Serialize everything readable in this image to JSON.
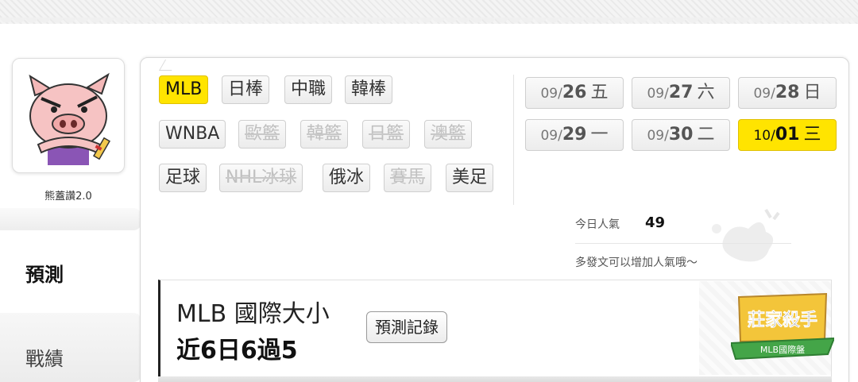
{
  "user": {
    "name": "熊蓋讚2.0"
  },
  "sidebar": {
    "predict_label": "預測",
    "record_label": "戰績"
  },
  "leagues": [
    {
      "label": "MLB",
      "state": "active"
    },
    {
      "label": "日棒",
      "state": "normal"
    },
    {
      "label": "中職",
      "state": "normal"
    },
    {
      "label": "韓棒",
      "state": "normal"
    },
    {
      "label": "WNBA",
      "state": "normal"
    },
    {
      "label": "歐籃",
      "state": "disabled"
    },
    {
      "label": "韓籃",
      "state": "disabled"
    },
    {
      "label": "日籃",
      "state": "disabled"
    },
    {
      "label": "澳籃",
      "state": "disabled"
    },
    {
      "label": "足球",
      "state": "normal"
    },
    {
      "label": "NHL冰球",
      "state": "disabled"
    },
    {
      "label": "俄冰",
      "state": "normal"
    },
    {
      "label": "賽馬",
      "state": "disabled"
    },
    {
      "label": "美足",
      "state": "normal"
    }
  ],
  "dates": [
    {
      "month": "09/",
      "day": "26",
      "weekday": "五",
      "active": false
    },
    {
      "month": "09/",
      "day": "27",
      "weekday": "六",
      "active": false
    },
    {
      "month": "09/",
      "day": "28",
      "weekday": "日",
      "active": false
    },
    {
      "month": "09/",
      "day": "29",
      "weekday": "一",
      "active": false
    },
    {
      "month": "09/",
      "day": "30",
      "weekday": "二",
      "active": false
    },
    {
      "month": "10/",
      "day": "01",
      "weekday": "三",
      "active": true
    }
  ],
  "popularity": {
    "label": "今日人氣",
    "value": "49",
    "note": "多發文可以增加人氣哦～"
  },
  "prediction": {
    "title": "MLB 國際大小",
    "summary": "近6日6過5",
    "record_button": "預測記錄",
    "badge": {
      "line1": "莊家殺手",
      "line2": "MLB國際盤"
    }
  },
  "colors": {
    "active": "#ffe400",
    "tag_border": "#cfcfcf",
    "disabled_text": "#c0c0c0"
  }
}
